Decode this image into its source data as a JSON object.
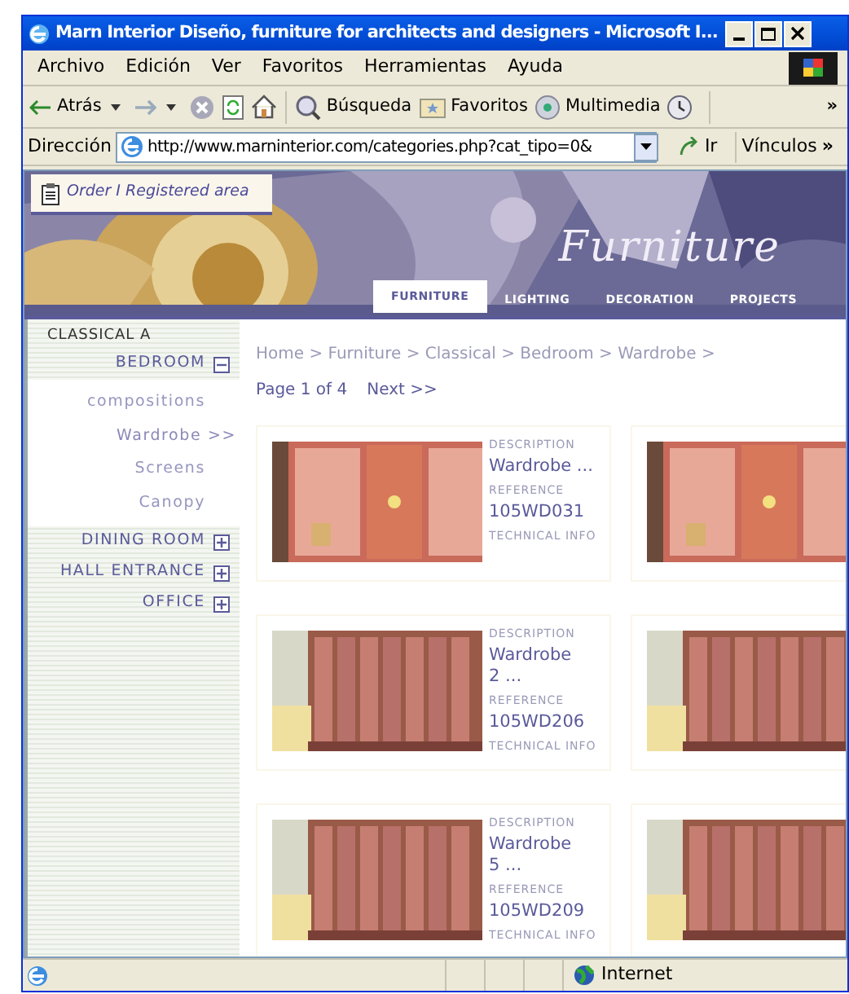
{
  "window": {
    "title": "Marn Interior Diseño, furniture for architects and designers - Microsoft I..."
  },
  "menu": [
    "Archivo",
    "Edición",
    "Ver",
    "Favoritos",
    "Herramientas",
    "Ayuda"
  ],
  "toolbar": [
    {
      "kind": "back",
      "label": "Atrás"
    },
    {
      "kind": "forward"
    },
    {
      "kind": "stop"
    },
    {
      "kind": "refresh"
    },
    {
      "kind": "home"
    },
    {
      "kind": "search",
      "label": "Búsqueda"
    },
    {
      "kind": "favorites",
      "label": "Favoritos"
    },
    {
      "kind": "media",
      "label": "Multimedia"
    },
    {
      "kind": "history"
    }
  ],
  "toolbar_more": "»",
  "address": {
    "label": "Dirección",
    "url": "http://www.marninterior.com/categories.php?cat_tipo=0&",
    "go": "Ir",
    "links": "Vínculos",
    "links_more": "»"
  },
  "site": {
    "order_link": "Order I Registered area",
    "logo": "Furniture",
    "nav": [
      {
        "label": "FURNITURE",
        "selected": true
      },
      {
        "label": "LIGHTING",
        "selected": false
      },
      {
        "label": "DECORATION",
        "selected": false
      },
      {
        "label": "PROJECTS",
        "selected": false
      }
    ],
    "sidebar": {
      "heading": "CLASSICAL A",
      "items": [
        {
          "label": "BEDROOM",
          "expanded": true,
          "children": [
            {
              "label": "compositions",
              "selected": false
            },
            {
              "label": "Wardrobe >>",
              "selected": true
            },
            {
              "label": "Screens",
              "selected": false
            },
            {
              "label": "Canopy",
              "selected": false
            }
          ]
        },
        {
          "label": "DINING ROOM",
          "expanded": false
        },
        {
          "label": "HALL ENTRANCE",
          "expanded": false
        },
        {
          "label": "OFFICE",
          "expanded": false
        }
      ]
    },
    "breadcrumb": "Home > Furniture > Classical > Bedroom > Wardrobe >",
    "pager": {
      "page": "Page 1 of 4",
      "next": "Next >>"
    },
    "products": [
      {
        "kind": "card",
        "description_label": "DESCRIPTION",
        "description": "Wardrobe ...",
        "reference_label": "REFERENCE",
        "reference": "105WD031",
        "info": "TECHNICAL INFO"
      },
      {
        "kind": "picture"
      },
      {
        "kind": "card",
        "description_label": "DESCRIPTION",
        "description": "Wardrobe 2 ...",
        "reference_label": "REFERENCE",
        "reference": "105WD206",
        "info": "TECHNICAL INFO"
      },
      {
        "kind": "picture"
      },
      {
        "kind": "card",
        "description_label": "DESCRIPTION",
        "description": "Wardrobe 5 ...",
        "reference_label": "REFERENCE",
        "reference": "105WD209",
        "info": "TECHNICAL INFO"
      },
      {
        "kind": "picture"
      }
    ]
  },
  "status_bar": {
    "zone": "Internet"
  }
}
